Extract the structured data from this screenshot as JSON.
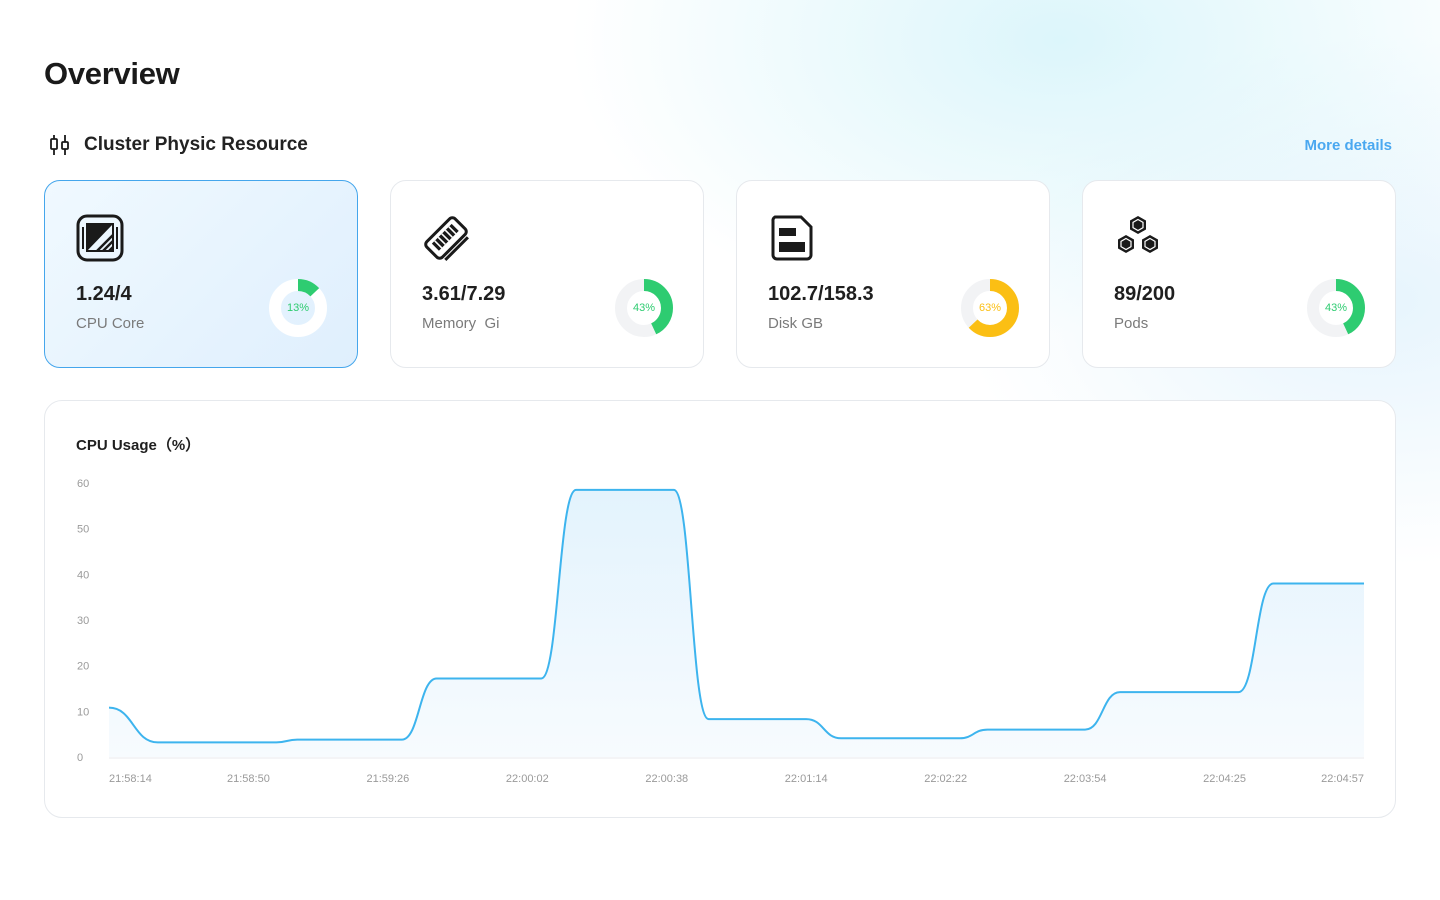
{
  "page": {
    "title": "Overview"
  },
  "section": {
    "title": "Cluster Physic Resource",
    "icon": "candlestick-icon",
    "more_link": "More details"
  },
  "cards": [
    {
      "value": "1.24/4",
      "label": "CPU Core",
      "percent": 13,
      "percent_text": "13%",
      "color": "#2ecc71",
      "icon": "cpu-chip-icon",
      "active": true
    },
    {
      "value": "3.61/7.29",
      "label": "Memory  Gi",
      "percent": 43,
      "percent_text": "43%",
      "color": "#2ecc71",
      "icon": "memory-stick-icon",
      "active": false
    },
    {
      "value": "102.7/158.3",
      "label": "Disk GB",
      "percent": 63,
      "percent_text": "63%",
      "color": "#fbbf14",
      "icon": "disk-icon",
      "active": false
    },
    {
      "value": "89/200",
      "label": "Pods",
      "percent": 43,
      "percent_text": "43%",
      "color": "#2ecc71",
      "icon": "hexagon-cluster-icon",
      "active": false
    }
  ],
  "chart": {
    "title": "CPU Usage（%）"
  },
  "chart_data": {
    "type": "area",
    "title": "CPU Usage（%）",
    "xlabel": "",
    "ylabel": "",
    "ylim": [
      0,
      60
    ],
    "yticks": [
      "0",
      "10",
      "20",
      "30",
      "40",
      "50",
      "60"
    ],
    "x_tick_labels": [
      "21:58:14",
      "21:58:50",
      "21:59:26",
      "22:00:02",
      "22:00:38",
      "22:01:14",
      "22:02:22",
      "22:03:54",
      "22:04:25",
      "22:04:57"
    ],
    "series": [
      {
        "values": [
          10.8,
          3.2,
          3.2,
          3.8,
          3.8,
          17.2,
          17.2,
          58.5,
          58.5,
          8.3,
          8.3,
          4.1,
          4.1,
          6.0,
          6.0,
          14.2,
          14.2,
          38.0,
          38.0
        ],
        "x_pos": [
          0,
          0.35,
          1.2,
          1.35,
          2.1,
          2.35,
          3.1,
          3.35,
          4.05,
          4.3,
          5.0,
          5.25,
          6.1,
          6.3,
          7.0,
          7.25,
          8.1,
          8.35,
          9.0
        ]
      }
    ],
    "line_color": "#3db4ee",
    "fill_color": "#e3f3fd",
    "grid": false
  }
}
